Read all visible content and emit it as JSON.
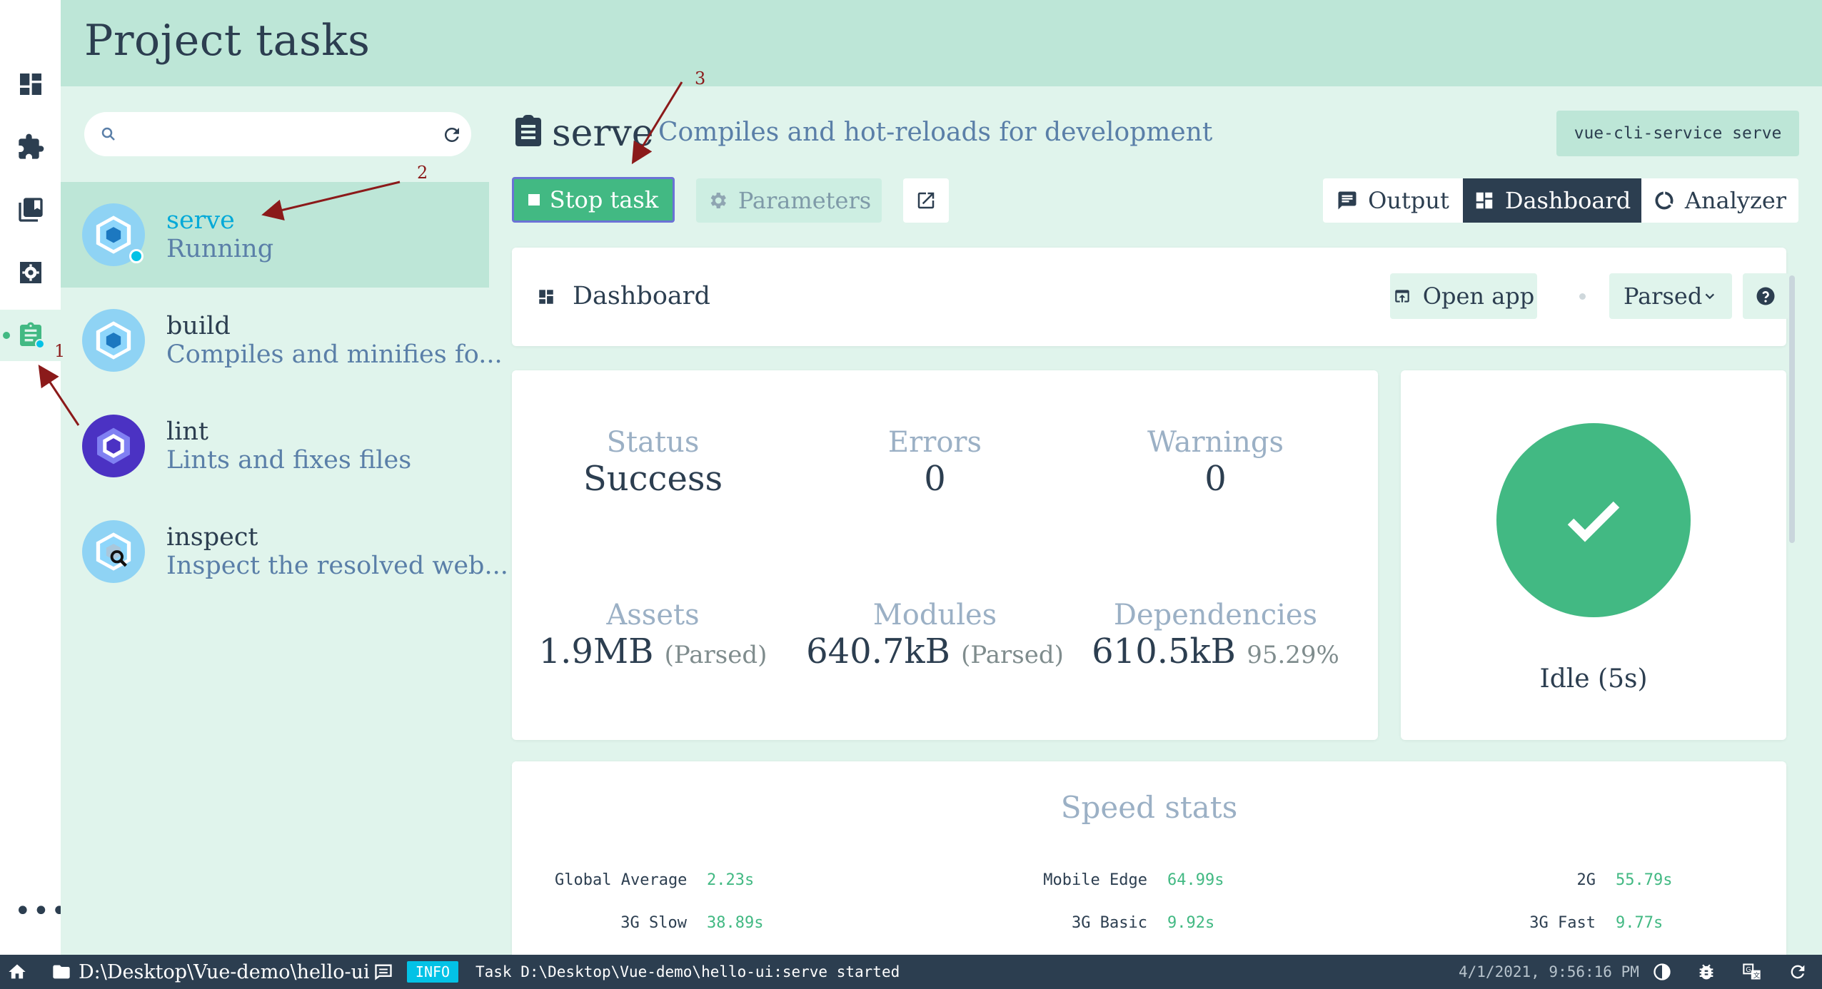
{
  "header": {
    "title": "Project tasks"
  },
  "nav": {
    "items": [
      {
        "name": "dashboard",
        "icon": "dashboard-icon"
      },
      {
        "name": "plugins",
        "icon": "puzzle-icon"
      },
      {
        "name": "dependencies",
        "icon": "library-books-icon"
      },
      {
        "name": "configuration",
        "icon": "settings-icon"
      },
      {
        "name": "tasks",
        "icon": "assignment-icon",
        "active": true
      }
    ],
    "more_icon": "more-horizontal-icon"
  },
  "task_list": {
    "search": {
      "placeholder": "",
      "value": ""
    },
    "tasks": [
      {
        "name": "serve",
        "description": "Running",
        "selected": true,
        "running": true,
        "icon": "webpack-icon"
      },
      {
        "name": "build",
        "description": "Compiles and minifies fo...",
        "icon": "webpack-icon"
      },
      {
        "name": "lint",
        "description": "Lints and fixes files",
        "icon": "eslint-icon"
      },
      {
        "name": "inspect",
        "description": "Inspect the resolved web...",
        "icon": "webpack-inspect-icon"
      }
    ]
  },
  "task_detail": {
    "name": "serve",
    "description": "Compiles and hot-reloads for development",
    "command": "vue-cli-service serve",
    "stop_label": "Stop task",
    "parameters_label": "Parameters",
    "tabs": {
      "output": "Output",
      "dashboard": "Dashboard",
      "analyzer": "Analyzer"
    },
    "active_tab": "dashboard"
  },
  "dashboard": {
    "title": "Dashboard",
    "open_app_label": "Open app",
    "size_mode": "Parsed",
    "stats": {
      "status_label": "Status",
      "status_value": "Success",
      "errors_label": "Errors",
      "errors_value": "0",
      "warnings_label": "Warnings",
      "warnings_value": "0",
      "assets_label": "Assets",
      "assets_value": "1.9MB",
      "assets_note": "(Parsed)",
      "modules_label": "Modules",
      "modules_value": "640.7kB",
      "modules_note": "(Parsed)",
      "dependencies_label": "Dependencies",
      "dependencies_value": "610.5kB",
      "dependencies_note": "95.29%"
    },
    "idle_text": "Idle (5s)",
    "speed_stats": {
      "title": "Speed stats",
      "rows": [
        {
          "label": "Global Average",
          "value": "2.23s"
        },
        {
          "label": "Mobile Edge",
          "value": "64.99s"
        },
        {
          "label": "2G",
          "value": "55.79s"
        },
        {
          "label": "3G Slow",
          "value": "38.89s"
        },
        {
          "label": "3G Basic",
          "value": "9.92s"
        },
        {
          "label": "3G Fast",
          "value": "9.77s"
        }
      ]
    }
  },
  "annotations": {
    "n1": "1",
    "n2": "2",
    "n3": "3"
  },
  "statusbar": {
    "path": "D:\\Desktop\\Vue-demo\\hello-ui",
    "level": "INFO",
    "message": "Task D:\\Desktop\\Vue-demo\\hello-ui:serve started",
    "time": "4/1/2021, 9:56:16 PM"
  },
  "colors": {
    "accent": "#42b983",
    "dark": "#2c3e50",
    "info": "#03c2e6",
    "bg": "#e0f4ec",
    "header": "#bde6d7"
  }
}
